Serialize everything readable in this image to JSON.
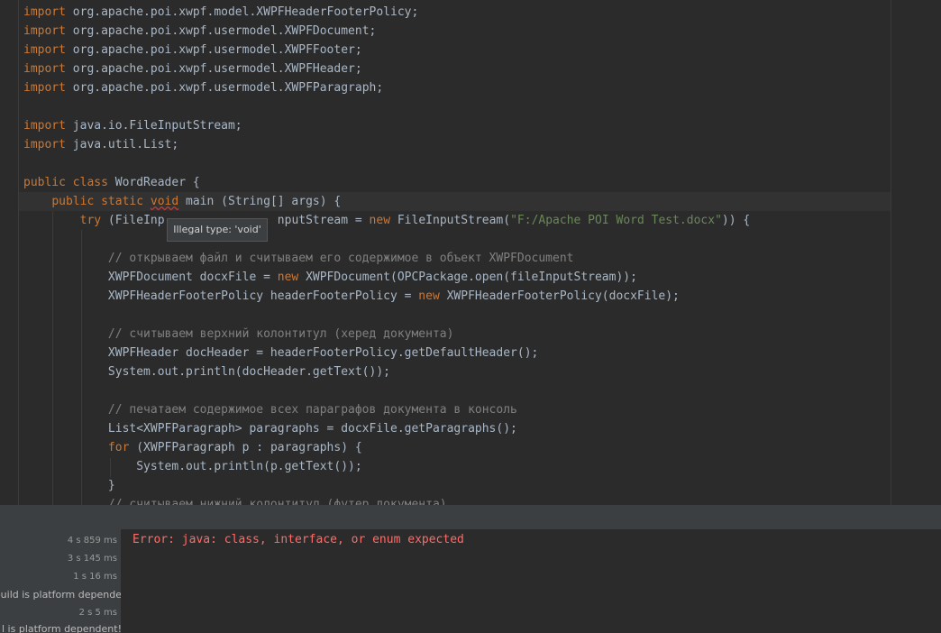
{
  "colors": {
    "keyword": "#cc7832",
    "text": "#a9b7c6",
    "string": "#6a8759",
    "comment": "#808080",
    "error": "#ff6b68",
    "editor_bg": "#2b2b2b",
    "panel_bg": "#3c3f41"
  },
  "editor": {
    "lines": [
      {
        "k": "import",
        "t": " org.apache.poi.xwpf.model.XWPFHeaderFooterPolicy;"
      },
      {
        "k": "import",
        "t": " org.apache.poi.xwpf.usermodel.XWPFDocument;"
      },
      {
        "k": "import",
        "t": " org.apache.poi.xwpf.usermodel.XWPFFooter;"
      },
      {
        "k": "import",
        "t": " org.apache.poi.xwpf.usermodel.XWPFHeader;"
      },
      {
        "k": "import",
        "t": " org.apache.poi.xwpf.usermodel.XWPFParagraph;"
      },
      {
        "k": "import",
        "t": " java.io.FileInputStream;"
      },
      {
        "k": "import",
        "t": " java.util.List;"
      },
      {
        "k": "public class",
        "t": " WordReader {"
      },
      {
        "i": "    ",
        "k": "public static",
        "bad": "void",
        "t": " main (String[] args) {"
      },
      {
        "i": "        ",
        "k": "try",
        "t": " (FileInp",
        "gap": "                ",
        "t2": "nputStream = ",
        "k2": "new",
        "t3": " FileInputStream(",
        "s": "\"F:/Apache POI Word Test.docx\"",
        "t4": ")) {"
      },
      {
        "i": "            ",
        "c": "// открываем файл и считываем его содержимое в объект XWPFDocument"
      },
      {
        "i": "            ",
        "t": "XWPFDocument docxFile = ",
        "k2": "new",
        "t3": " XWPFDocument(OPCPackage.open(fileInputStream));"
      },
      {
        "i": "            ",
        "t": "XWPFHeaderFooterPolicy headerFooterPolicy = ",
        "k2": "new",
        "t3": " XWPFHeaderFooterPolicy(docxFile);"
      },
      {
        "i": "            ",
        "c": "// считываем верхний колонтитул (херед документа)"
      },
      {
        "i": "            ",
        "t": "XWPFHeader docHeader = headerFooterPolicy.getDefaultHeader();"
      },
      {
        "i": "            ",
        "t": "System.out.println(docHeader.getText());"
      },
      {
        "i": "            ",
        "c": "// печатаем содержимое всех параграфов документа в консоль"
      },
      {
        "i": "            ",
        "t": "List<XWPFParagraph> paragraphs = docxFile.getParagraphs();"
      },
      {
        "i": "            ",
        "k": "for",
        "t": " (XWPFParagraph p : paragraphs) {"
      },
      {
        "i": "                ",
        "t": "System.out.println(p.getText());"
      },
      {
        "i": "            ",
        "t": "}"
      },
      {
        "i": "            ",
        "c": "// считываем нижний колонтитул (футер документа)"
      }
    ]
  },
  "tooltip": {
    "text": "Illegal type: 'void'"
  },
  "build": {
    "items": [
      {
        "text": "4 s 859 ms",
        "kind": "time"
      },
      {
        "text": "3 s 145 ms",
        "kind": "time"
      },
      {
        "text": "1 s 16 ms",
        "kind": "time"
      },
      {
        "text": "build is platform depende",
        "kind": "msg"
      },
      {
        "text": "2 s 5 ms",
        "kind": "time"
      },
      {
        "text": "l is platform dependent!",
        "kind": "msg"
      }
    ],
    "error": "Error: java: class, interface, or enum expected"
  }
}
